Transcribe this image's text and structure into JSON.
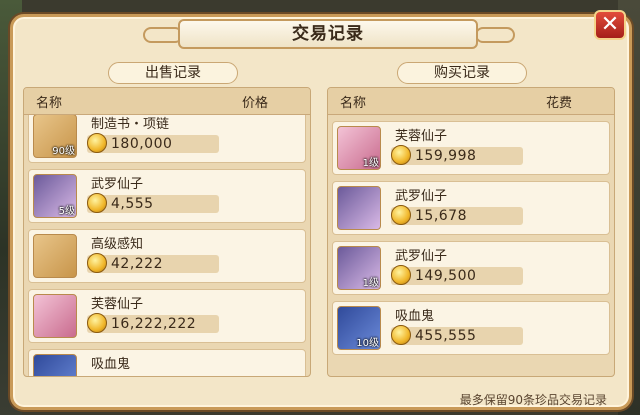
{
  "window": {
    "title": "交易记录",
    "close_label": "✕"
  },
  "sell": {
    "header": "出售记录",
    "col_name": "名称",
    "col_price": "价格",
    "rows": [
      {
        "name": "制造书・项链",
        "level": "90级",
        "price": "180,000",
        "icon": "scroll-icon"
      },
      {
        "name": "武罗仙子",
        "level": "5级",
        "price": "4,555",
        "icon": "character-icon"
      },
      {
        "name": "高级感知",
        "level": "",
        "price": "42,222",
        "icon": "scroll-icon"
      },
      {
        "name": "芙蓉仙子",
        "level": "",
        "price": "16,222,222",
        "icon": "character-icon"
      },
      {
        "name": "吸血鬼",
        "level": "",
        "price": "",
        "icon": "character-icon"
      }
    ]
  },
  "buy": {
    "header": "购买记录",
    "col_name": "名称",
    "col_cost": "花费",
    "rows": [
      {
        "name": "芙蓉仙子",
        "level": "1级",
        "price": "159,998",
        "icon": "character-icon"
      },
      {
        "name": "武罗仙子",
        "level": "",
        "price": "15,678",
        "icon": "character-icon"
      },
      {
        "name": "武罗仙子",
        "level": "1级",
        "price": "149,500",
        "icon": "character-icon"
      },
      {
        "name": "吸血鬼",
        "level": "10级",
        "price": "455,555",
        "icon": "character-icon"
      }
    ]
  },
  "footer": "最多保留90条珍品交易记录"
}
